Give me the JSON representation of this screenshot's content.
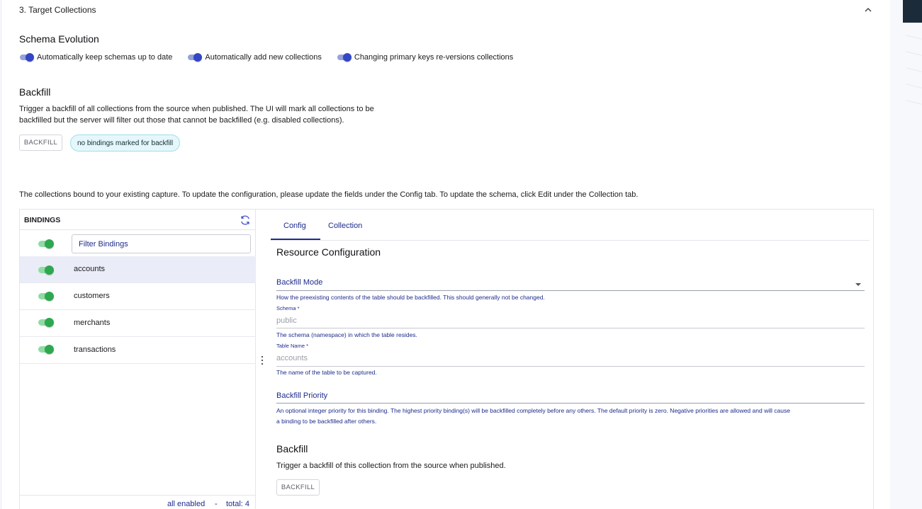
{
  "section": {
    "title": "3. Target Collections",
    "collapse_icon": "chevron-up-icon"
  },
  "schema_evolution": {
    "title": "Schema Evolution",
    "toggles": [
      {
        "label": "Automatically keep schemas up to date",
        "enabled": true
      },
      {
        "label": "Automatically add new collections",
        "enabled": true
      },
      {
        "label": "Changing primary keys re-versions collections",
        "enabled": true
      }
    ]
  },
  "backfill": {
    "title": "Backfill",
    "description_line1": "Trigger a backfill of all collections from the source when published. The UI will mark all collections to be",
    "description_line2": "backfilled but the server will filter out those that cannot be backfilled (e.g. disabled collections).",
    "button_label": "BACKFILL",
    "chip_label": "no bindings marked for backfill"
  },
  "intro_text": "The collections bound to your existing capture. To update the configuration, please update the fields under the Config tab. To update the schema, click Edit under the Collection tab.",
  "bindings": {
    "title": "BINDINGS",
    "refresh_icon": "refresh-icon",
    "filter_placeholder": "Filter Bindings",
    "all_enabled": true,
    "items": [
      {
        "name": "accounts",
        "enabled": true,
        "selected": true
      },
      {
        "name": "customers",
        "enabled": true,
        "selected": false
      },
      {
        "name": "merchants",
        "enabled": true,
        "selected": false
      },
      {
        "name": "transactions",
        "enabled": true,
        "selected": false
      }
    ],
    "footer_status": "all enabled",
    "footer_sep": "-",
    "footer_total": "total: 4"
  },
  "detail": {
    "tabs": [
      {
        "label": "Config",
        "active": true
      },
      {
        "label": "Collection",
        "active": false
      }
    ],
    "resource_title": "Resource Configuration",
    "backfill_mode": {
      "label": "Backfill Mode",
      "helper": "How the preexisting contents of the table should be backfilled. This should generally not be changed."
    },
    "schema": {
      "label": "Schema *",
      "value": "public",
      "helper": "The schema (namespace) in which the table resides."
    },
    "table_name": {
      "label": "Table Name *",
      "value": "accounts",
      "helper": "The name of the table to be captured."
    },
    "backfill_priority": {
      "label": "Backfill Priority",
      "helper_line1": "An optional integer priority for this binding. The highest priority binding(s) will be backfilled completely before any others. The default priority is zero. Negative priorities are allowed and will cause",
      "helper_line2": "a binding to be backfilled after others."
    },
    "backfill": {
      "title": "Backfill",
      "description": "Trigger a backfill of this collection from the source when published.",
      "button_label": "BACKFILL"
    }
  },
  "colors": {
    "accent": "#1d2c8c",
    "toggle_blue": "#3346c6",
    "toggle_green": "#2ea84f",
    "chip_bg": "#e6f7fb",
    "selected_row": "#eaecf7"
  }
}
